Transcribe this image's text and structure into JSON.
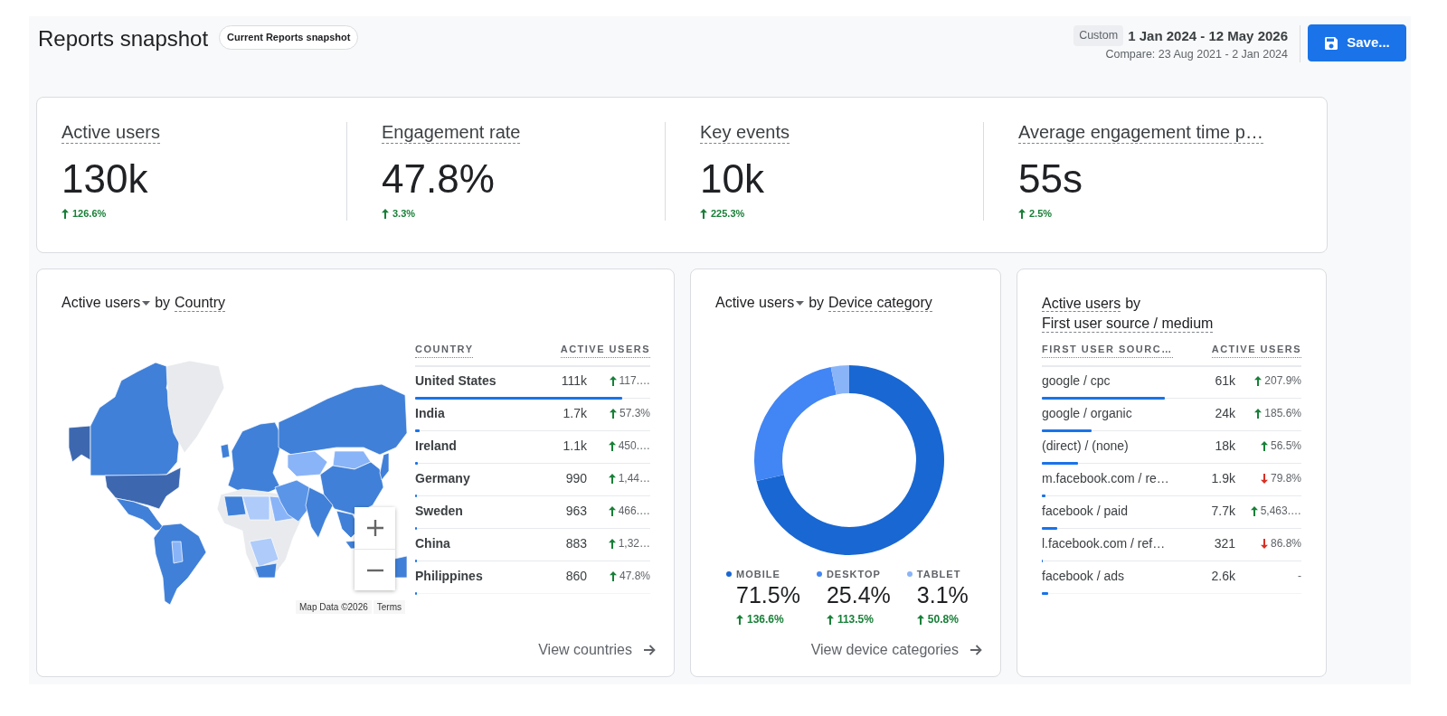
{
  "header": {
    "title": "Reports snapshot",
    "badge": "Current Reports snapshot",
    "date_preset": "Custom",
    "date_range": "1 Jan 2024 - 12 May 2026",
    "compare": "Compare: 23 Aug 2021 - 2 Jan 2024",
    "save_button": "Save..."
  },
  "kpis": [
    {
      "label": "Active users",
      "value": "130k",
      "change": "126.6%",
      "increase": true
    },
    {
      "label": "Engagement rate",
      "value": "47.8%",
      "change": "3.3%",
      "increase": true
    },
    {
      "label": "Key events",
      "value": "10k",
      "change": "225.3%",
      "increase": true
    },
    {
      "label": "Average engagement time p…",
      "value": "55s",
      "change": "2.5%",
      "increase": true
    }
  ],
  "country_card": {
    "title": {
      "metric": "Active users",
      "dropdown": true,
      "joiner": "by",
      "dimension": "Country"
    },
    "map": {
      "controls": [
        {
          "kind": "zoom_in"
        },
        {
          "kind": "zoom_out"
        }
      ],
      "attribution": "Map Data ©2026",
      "terms": "Terms"
    },
    "table": {
      "columns": [
        "COUNTRY",
        "ACTIVE USERS"
      ],
      "rows": [
        {
          "name": "United States",
          "value": "111k",
          "change": "117.…",
          "increase": true,
          "level": 0.88
        },
        {
          "name": "India",
          "value": "1.7k",
          "change": "57.3%",
          "increase": true,
          "level": 0.02
        },
        {
          "name": "Ireland",
          "value": "1.1k",
          "change": "450.…",
          "increase": true,
          "level": 0.012
        },
        {
          "name": "Germany",
          "value": "990",
          "change": "1,44…",
          "increase": true,
          "level": 0.009
        },
        {
          "name": "Sweden",
          "value": "963",
          "change": "466.…",
          "increase": true,
          "level": 0.009
        },
        {
          "name": "China",
          "value": "883",
          "change": "1,32…",
          "increase": true,
          "level": 0.009
        },
        {
          "name": "Philippines",
          "value": "860",
          "change": "47.8%",
          "increase": true,
          "level": 0.009
        }
      ]
    },
    "link": "View countries"
  },
  "device_card": {
    "title": {
      "metric": "Active users",
      "dropdown": true,
      "joiner": "by",
      "dimension": "Device category"
    },
    "chart_data": {
      "type": "donut",
      "categories": [
        "MOBILE",
        "DESKTOP",
        "TABLET"
      ],
      "values": [
        71.5,
        25.4,
        3.1
      ]
    },
    "legend": [
      {
        "color": "#1967d2",
        "share": "71.5%",
        "change": "136.6%",
        "increase": true
      },
      {
        "color": "#4285f4",
        "share": "25.4%",
        "change": "113.5%",
        "increase": true
      },
      {
        "color": "#8ab4f8",
        "share": "3.1%",
        "change": "50.8%",
        "increase": true
      }
    ],
    "link": "View device categories"
  },
  "source_card": {
    "title": {
      "metric": "Active users",
      "dropdown": false,
      "joiner": "by",
      "dimension": "First user source / medium"
    },
    "table": {
      "columns": [
        "FIRST USER SOURC…",
        "ACTIVE USERS"
      ],
      "rows": [
        {
          "name": "google / cpc",
          "value": "61k",
          "change": "207.9%",
          "increase": true,
          "level": 0.475
        },
        {
          "name": "google / organic",
          "value": "24k",
          "change": "185.6%",
          "increase": true,
          "level": 0.19
        },
        {
          "name": "(direct) / (none)",
          "value": "18k",
          "change": "56.5%",
          "increase": true,
          "level": 0.14
        },
        {
          "name": "m.facebook.com / re…",
          "value": "1.9k",
          "change": "79.8%",
          "increase": false,
          "level": 0.015
        },
        {
          "name": "facebook / paid",
          "value": "7.7k",
          "change": "5,463.…",
          "increase": true,
          "level": 0.06
        },
        {
          "name": "l.facebook.com / ref…",
          "value": "321",
          "change": "86.8%",
          "increase": false,
          "level": 0.005
        },
        {
          "name": "facebook / ads",
          "value": "2.6k",
          "change": "-",
          "level": 0.023
        }
      ]
    }
  }
}
